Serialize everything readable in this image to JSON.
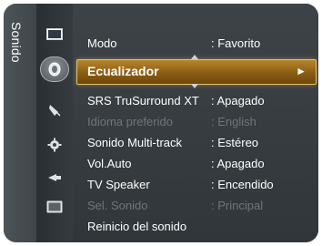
{
  "side_tab": {
    "label": "Sonido"
  },
  "icons": [
    {
      "name": "picture-icon"
    },
    {
      "name": "sound-icon"
    },
    {
      "name": "channel-icon"
    },
    {
      "name": "settings-icon"
    },
    {
      "name": "input-icon"
    },
    {
      "name": "application-icon"
    }
  ],
  "menu": {
    "items": [
      {
        "label": "Modo",
        "value": ": Favorito",
        "state": "normal"
      },
      {
        "label": "Ecualizador",
        "value": "",
        "state": "selected",
        "arrow": "►"
      },
      {
        "label": "SRS TruSurround XT",
        "value": ": Apagado",
        "state": "normal"
      },
      {
        "label": "Idioma preferido",
        "value": ": English",
        "state": "disabled"
      },
      {
        "label": "Sonido Multi-track",
        "value": ": Estéreo",
        "state": "normal"
      },
      {
        "label": "Vol.Auto",
        "value": ": Apagado",
        "state": "normal"
      },
      {
        "label": "TV Speaker",
        "value": ": Encendido",
        "state": "normal"
      },
      {
        "label": "Sel. Sonido",
        "value": ": Principal",
        "state": "disabled"
      },
      {
        "label": "Reinicio del sonido",
        "value": "",
        "state": "normal"
      }
    ]
  },
  "colors": {
    "highlight": "#a7761f",
    "text": "#ffffff",
    "disabled_text": "#6f767a",
    "panel": "#363c40"
  }
}
